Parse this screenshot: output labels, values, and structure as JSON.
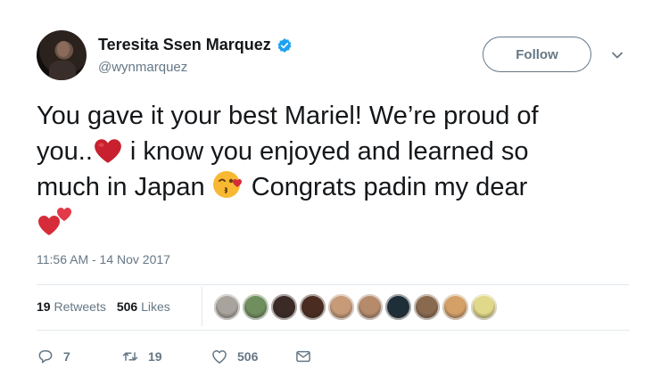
{
  "author": {
    "name": "Teresita Ssen Marquez",
    "handle": "@wynmarquez",
    "verified": true
  },
  "follow_button": {
    "label": "Follow"
  },
  "tweet": {
    "line1": "You gave it your best Mariel! We’re proud of",
    "line2a": "you..",
    "line2b": " i know you enjoyed and learned so",
    "line3a": "much in Japan ",
    "line3b": " Congrats padin my dear",
    "emojis": [
      "red-heart",
      "face-blowing-kiss",
      "two-hearts"
    ]
  },
  "timestamp": "11:56 AM - 14 Nov 2017",
  "stats": {
    "retweets_count": "19",
    "retweets_label": "Retweets",
    "likes_count": "506",
    "likes_label": "Likes",
    "liker_avatar_colors": [
      "#a8a39c",
      "#6f8f5e",
      "#3b2a26",
      "#4a2c20",
      "#c79a78",
      "#b58b6b",
      "#1e2f3a",
      "#8a6a4f",
      "#d4a068",
      "#e0d88a"
    ]
  },
  "actions": {
    "reply_count": "7",
    "retweet_count": "19",
    "like_count": "506"
  },
  "colors": {
    "text": "#14171a",
    "secondary": "#657786",
    "verified": "#1da1f2",
    "heart": "#d62c3a",
    "divider": "#e1e8ed"
  }
}
